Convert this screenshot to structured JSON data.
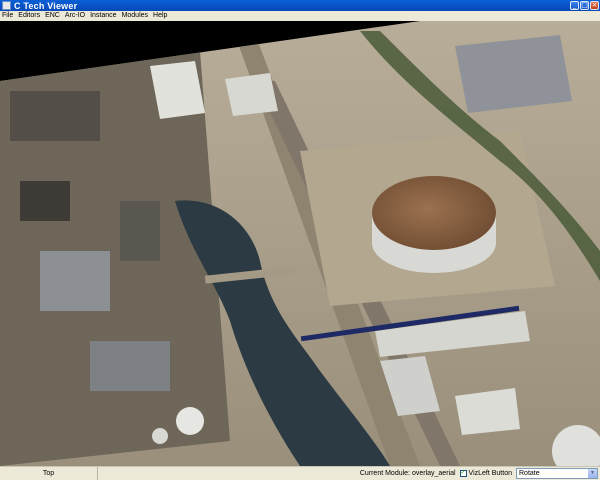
{
  "window": {
    "title": "C Tech Viewer",
    "buttons": {
      "minimize": "_",
      "maximize": "□",
      "close": "×"
    }
  },
  "menu": {
    "items": [
      "File",
      "Editors",
      "ENC",
      "Arc-IO",
      "Instance",
      "Modules",
      "Help"
    ]
  },
  "viewport": {
    "content": "aerial-overlay",
    "colors": {
      "background": "#000000",
      "water": "#2c3a44",
      "tank": "#8a6242",
      "ground": "#a69a82",
      "warehouse_roof": "#d6d6d0"
    }
  },
  "statusbar": {
    "view_label": "Top",
    "current_module": "Current Module: overlay_aerial",
    "vizleft_label": "VizLeft Button",
    "vizleft_checked": true,
    "mode_value": "Rotate"
  },
  "colors": {
    "titlebar": "#0a5fd6",
    "chrome": "#ece9d8"
  }
}
